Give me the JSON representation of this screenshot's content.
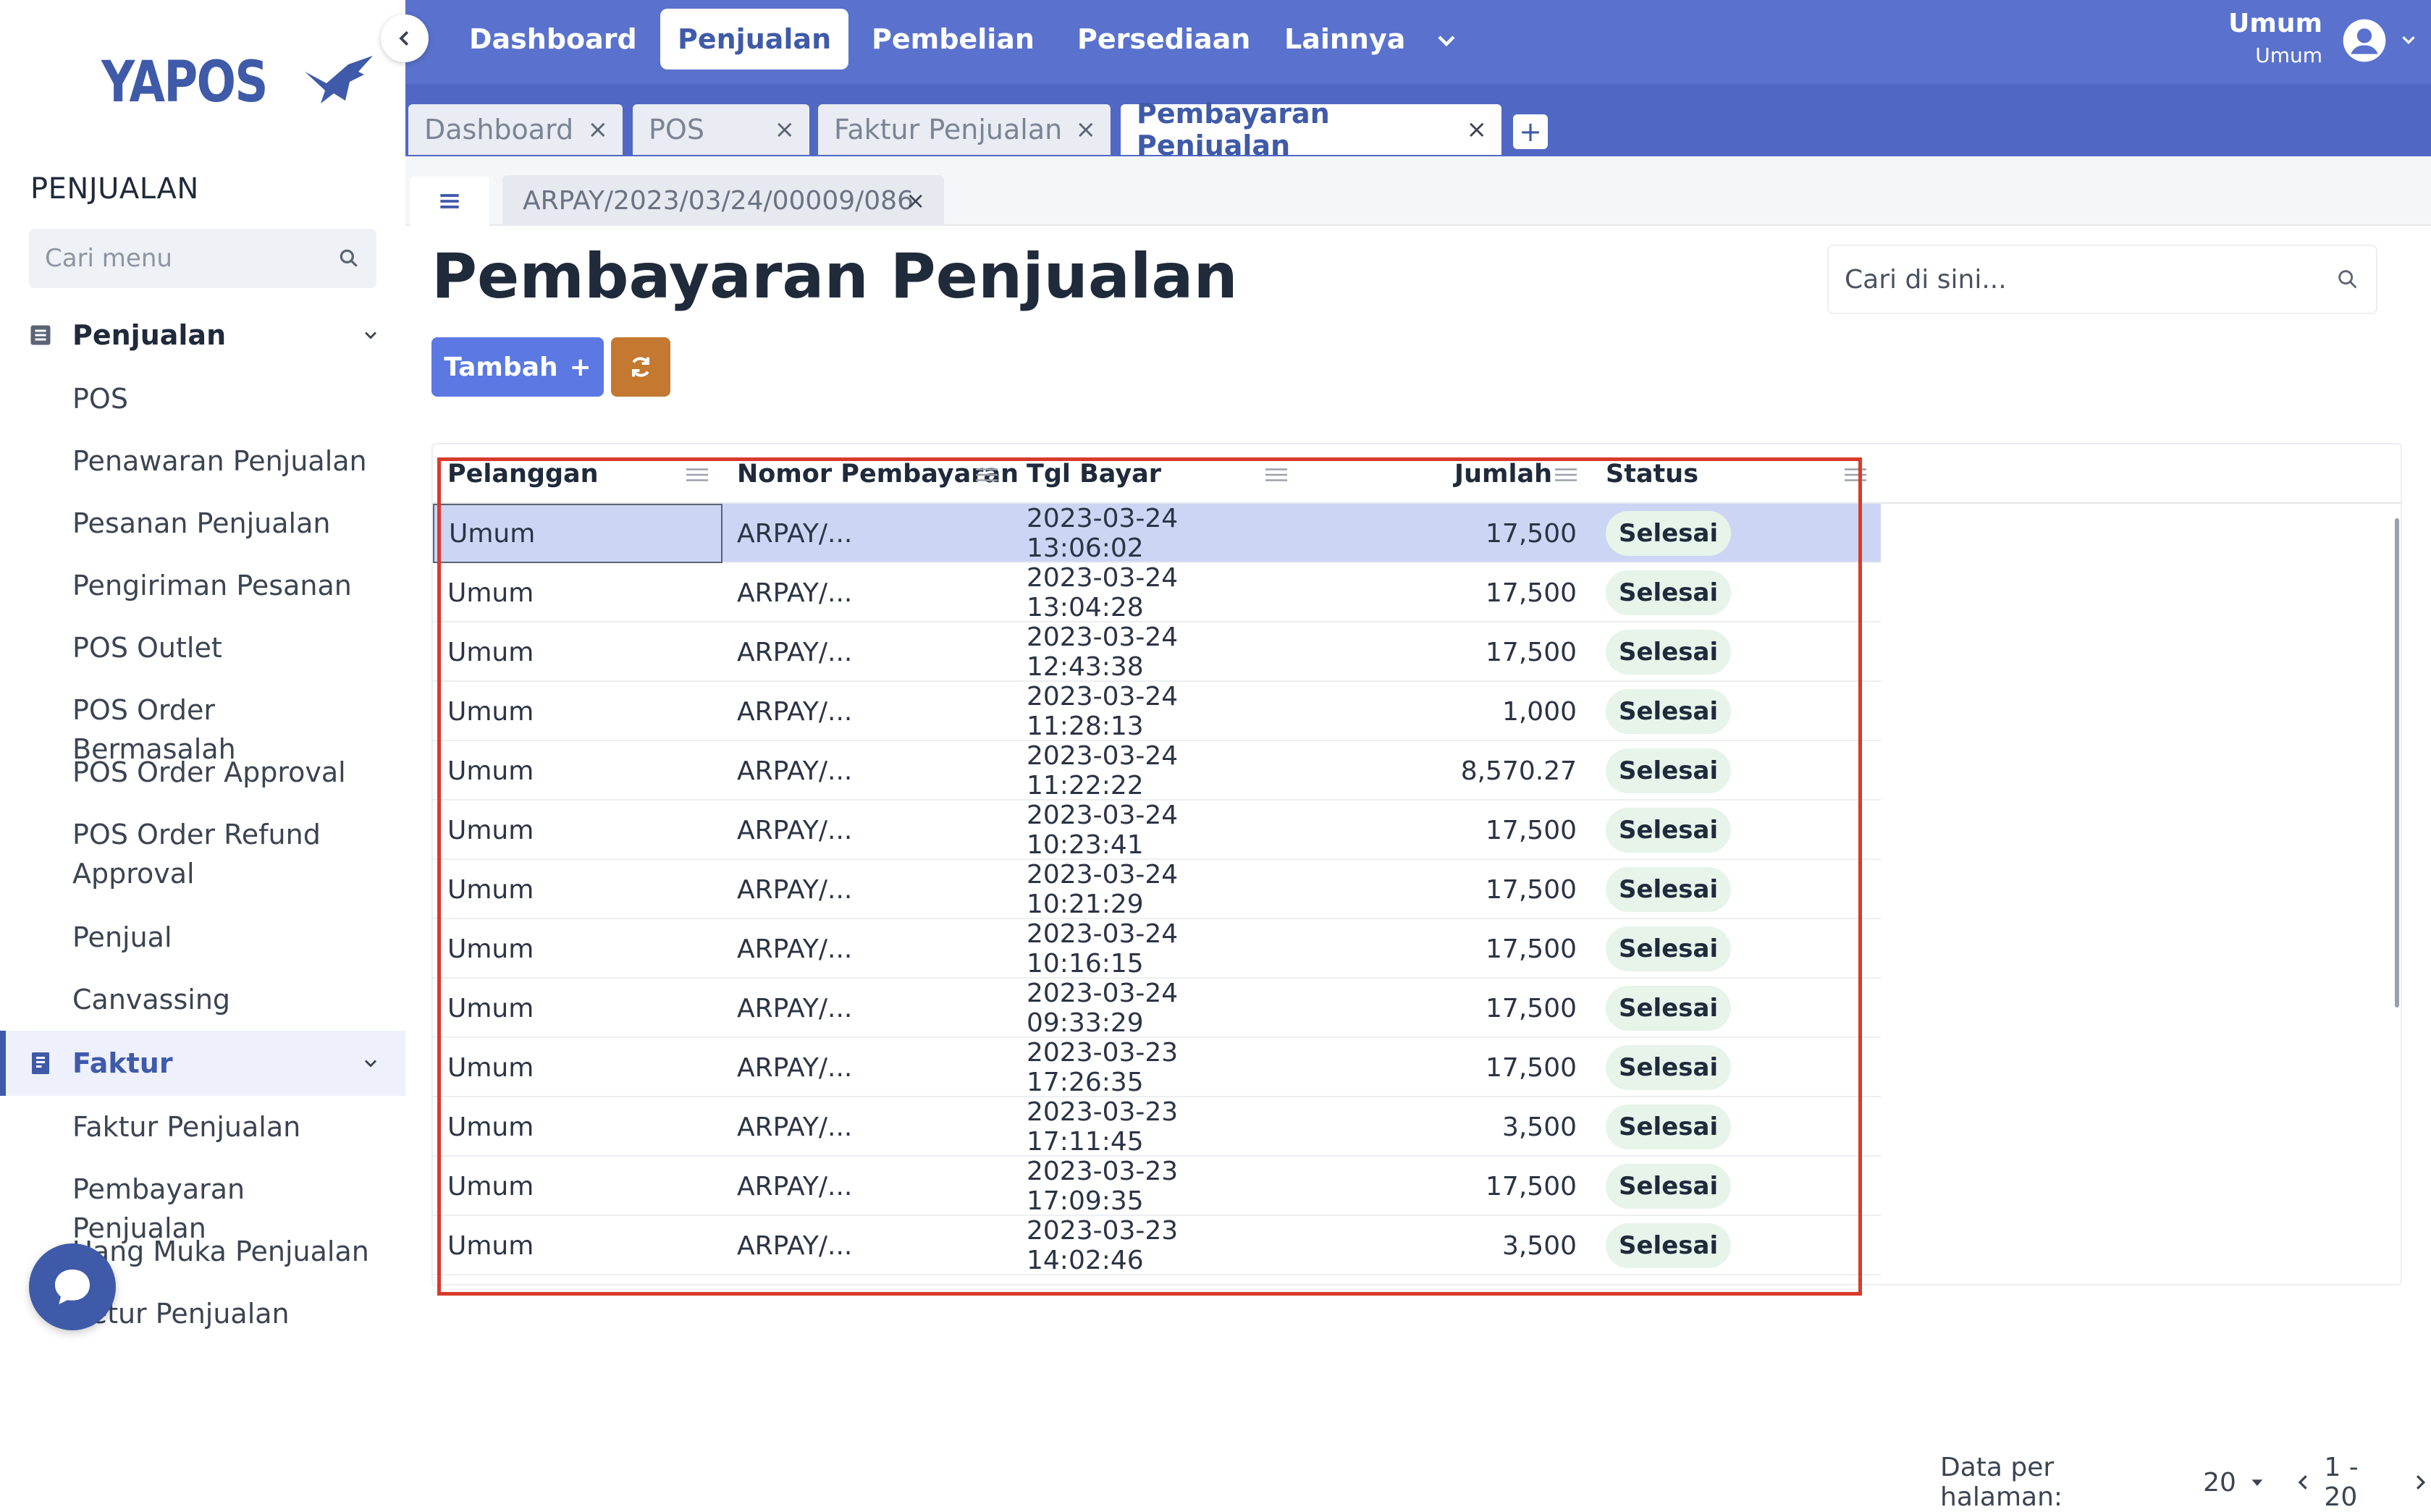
{
  "brand": {
    "logo_text": "YAPOS"
  },
  "sidebar": {
    "section_title": "PENJUALAN",
    "search_placeholder": "Cari menu",
    "groups": [
      {
        "label": "Penjualan",
        "icon": "list-icon",
        "items": [
          "POS",
          "Penawaran Penjualan",
          "Pesanan Penjualan",
          "Pengiriman Pesanan",
          "POS Outlet",
          "POS Order Bermasalah",
          "POS Order Approval",
          "POS Order Refund Approval",
          "Penjual",
          "Canvassing"
        ]
      },
      {
        "label": "Faktur",
        "icon": "receipt-icon",
        "items": [
          "Faktur Penjualan",
          "Pembayaran Penjualan",
          "Uang Muka Penjualan",
          "Retur Penjualan"
        ]
      }
    ]
  },
  "topnav": {
    "items": [
      "Dashboard",
      "Penjualan",
      "Pembelian",
      "Persediaan",
      "Lainnya"
    ],
    "active": "Penjualan",
    "user_name": "Umum",
    "user_sub": "Umum"
  },
  "tabs": [
    {
      "label": "Dashboard",
      "active": false
    },
    {
      "label": "POS",
      "active": false
    },
    {
      "label": "Faktur Penjualan",
      "active": false
    },
    {
      "label": "Pembayaran Penjualan",
      "active": true
    }
  ],
  "subtab": {
    "label": "ARPAY/2023/03/24/00009/086"
  },
  "page": {
    "title": "Pembayaran Penjualan",
    "search_placeholder": "Cari di sini...",
    "add_button": "Tambah",
    "add_symbol": "+"
  },
  "table": {
    "columns": [
      "Pelanggan",
      "Nomor Pembayaran",
      "Tgl Bayar",
      "Jumlah",
      "Status"
    ],
    "rows": [
      [
        "Umum",
        "ARPAY/...",
        "2023-03-24 13:06:02",
        "17,500",
        "Selesai"
      ],
      [
        "Umum",
        "ARPAY/...",
        "2023-03-24 13:04:28",
        "17,500",
        "Selesai"
      ],
      [
        "Umum",
        "ARPAY/...",
        "2023-03-24 12:43:38",
        "17,500",
        "Selesai"
      ],
      [
        "Umum",
        "ARPAY/...",
        "2023-03-24 11:28:13",
        "1,000",
        "Selesai"
      ],
      [
        "Umum",
        "ARPAY/...",
        "2023-03-24 11:22:22",
        "8,570.27",
        "Selesai"
      ],
      [
        "Umum",
        "ARPAY/...",
        "2023-03-24 10:23:41",
        "17,500",
        "Selesai"
      ],
      [
        "Umum",
        "ARPAY/...",
        "2023-03-24 10:21:29",
        "17,500",
        "Selesai"
      ],
      [
        "Umum",
        "ARPAY/...",
        "2023-03-24 10:16:15",
        "17,500",
        "Selesai"
      ],
      [
        "Umum",
        "ARPAY/...",
        "2023-03-24 09:33:29",
        "17,500",
        "Selesai"
      ],
      [
        "Umum",
        "ARPAY/...",
        "2023-03-23 17:26:35",
        "17,500",
        "Selesai"
      ],
      [
        "Umum",
        "ARPAY/...",
        "2023-03-23 17:11:45",
        "3,500",
        "Selesai"
      ],
      [
        "Umum",
        "ARPAY/...",
        "2023-03-23 17:09:35",
        "17,500",
        "Selesai"
      ],
      [
        "Umum",
        "ARPAY/...",
        "2023-03-23 14:02:46",
        "3,500",
        "Selesai"
      ]
    ]
  },
  "pagination": {
    "label": "Data per halaman:",
    "per_page": "20",
    "range": "1 - 20"
  },
  "colors": {
    "brand": "#3f5aa8",
    "topbar": "#5a72cd",
    "primary_button": "#5b78e3",
    "refresh_button": "#c47830",
    "status_badge": "#e6f4ea",
    "highlight": "#d93a2b"
  }
}
